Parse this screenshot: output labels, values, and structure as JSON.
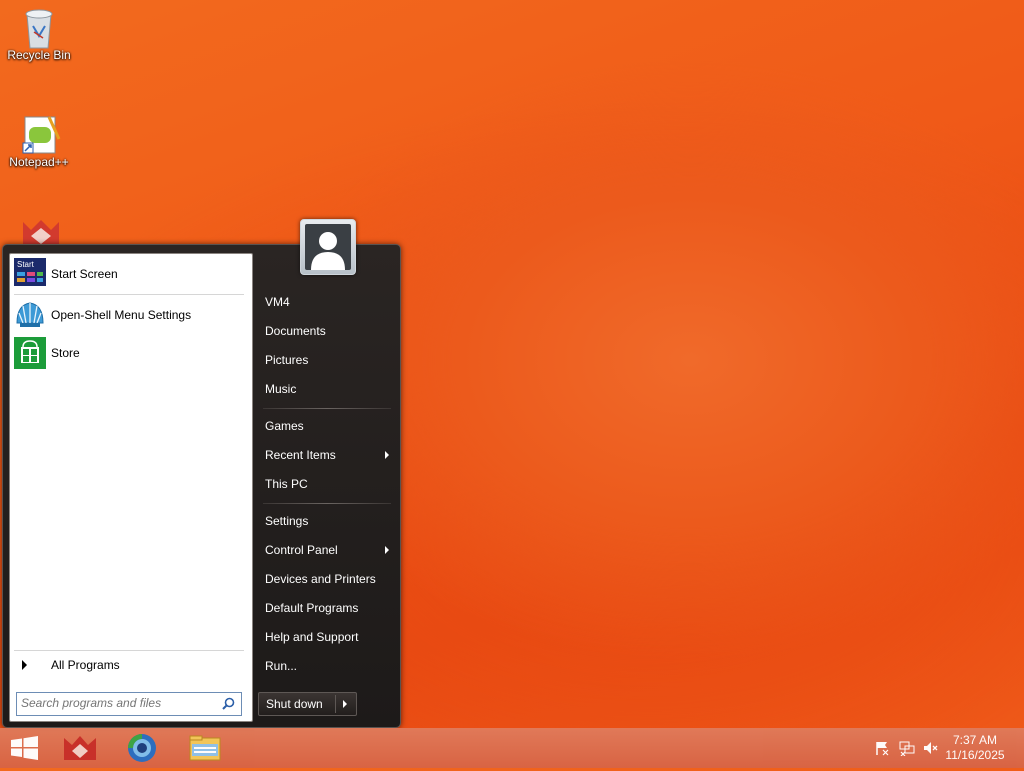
{
  "desktop": {
    "icons": [
      {
        "label": "Recycle Bin",
        "icon": "recycle-bin-icon"
      },
      {
        "label": "Notepad++",
        "icon": "notepad-plus-plus-icon"
      },
      {
        "label": "",
        "icon": "app-shortcut-icon"
      }
    ]
  },
  "start_menu": {
    "pinned": [
      {
        "label": "Start Screen",
        "icon": "start-screen-icon"
      },
      {
        "label": "Open-Shell Menu Settings",
        "icon": "open-shell-icon"
      },
      {
        "label": "Store",
        "icon": "store-icon"
      }
    ],
    "all_programs": "All Programs",
    "search_placeholder": "Search programs and files",
    "user_picture": "user-avatar-icon",
    "right_items": [
      {
        "label": "VM4"
      },
      {
        "label": "Documents"
      },
      {
        "label": "Pictures"
      },
      {
        "label": "Music"
      },
      {
        "label": "Games"
      },
      {
        "label": "Recent Items",
        "submenu": true
      },
      {
        "label": "This PC"
      },
      {
        "label": "Settings"
      },
      {
        "label": "Control Panel",
        "submenu": true
      },
      {
        "label": "Devices and Printers"
      },
      {
        "label": "Default Programs"
      },
      {
        "label": "Help and Support"
      },
      {
        "label": "Run..."
      }
    ],
    "shutdown_label": "Shut down"
  },
  "taskbar": {
    "buttons": [
      "start-windows-icon",
      "app-shortcut-icon",
      "browser-icon",
      "file-explorer-icon"
    ],
    "tray_icons": [
      "action-center-flag-icon",
      "network-icon",
      "volume-muted-icon"
    ],
    "clock": {
      "time": "7:37 AM",
      "date": "11/16/2025"
    }
  },
  "colors": {
    "wallpaper": "#f05a18",
    "taskbar": "#d86444",
    "menu_dark": "#1d1a19"
  }
}
